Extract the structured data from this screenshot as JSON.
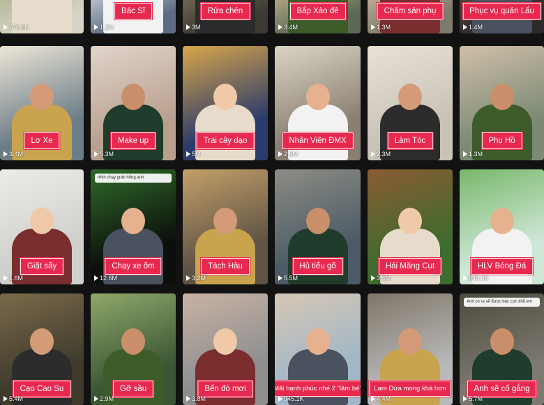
{
  "grid": {
    "cards": [
      {
        "title": "",
        "views": "770.8K"
      },
      {
        "title": "Bác Sĩ",
        "views": "1.2M"
      },
      {
        "title": "Rửa chén",
        "views": "3M"
      },
      {
        "title": "Bắp Xào đê",
        "views": "3.4M"
      },
      {
        "title": "Chăm sản phụ",
        "views": "1.3M"
      },
      {
        "title": "Phục vụ quán Lẩu",
        "views": "1.4M"
      },
      {
        "title": "Lơ Xe",
        "views": "3.4M"
      },
      {
        "title": "Make up",
        "views": "5.3M"
      },
      {
        "title": "Trái cây dạo",
        "views": "5M"
      },
      {
        "title": "Nhân Viên ĐMX",
        "views": "2.5M"
      },
      {
        "title": "Làm Tóc",
        "views": "2.3M"
      },
      {
        "title": "Phụ Hồ",
        "views": "1.3M"
      },
      {
        "title": "Giặt sấy",
        "views": "1.6M"
      },
      {
        "title": "Chạy xe ôm",
        "views": "12.6M",
        "comment": "nhìn chạy grab hồng anh"
      },
      {
        "title": "Tách Hàu",
        "views": "3.2M"
      },
      {
        "title": "Hủ tiếu gõ",
        "views": "5.5M"
      },
      {
        "title": "Hái Măng Cụt",
        "views": "3.4M"
      },
      {
        "title": "HLV Bóng Đá",
        "views": "840.3K"
      },
      {
        "title": "Cạo Cao Su",
        "views": "5.4M"
      },
      {
        "title": "Gỡ sầu",
        "views": "2.9M"
      },
      {
        "title": "Bến đò mơi",
        "views": "3.8M"
      },
      {
        "title": "Mãi hạnh phúc nhé 2 \"lâm bé\"",
        "views": "945.1K"
      },
      {
        "title": "Lam Dừa mong khá hơn",
        "views": "4.4M"
      },
      {
        "title": "Anh sẽ cố gắng",
        "views": "5.7M",
        "comment": "Anh có ra sẽ được bác cực khổ em"
      }
    ]
  }
}
